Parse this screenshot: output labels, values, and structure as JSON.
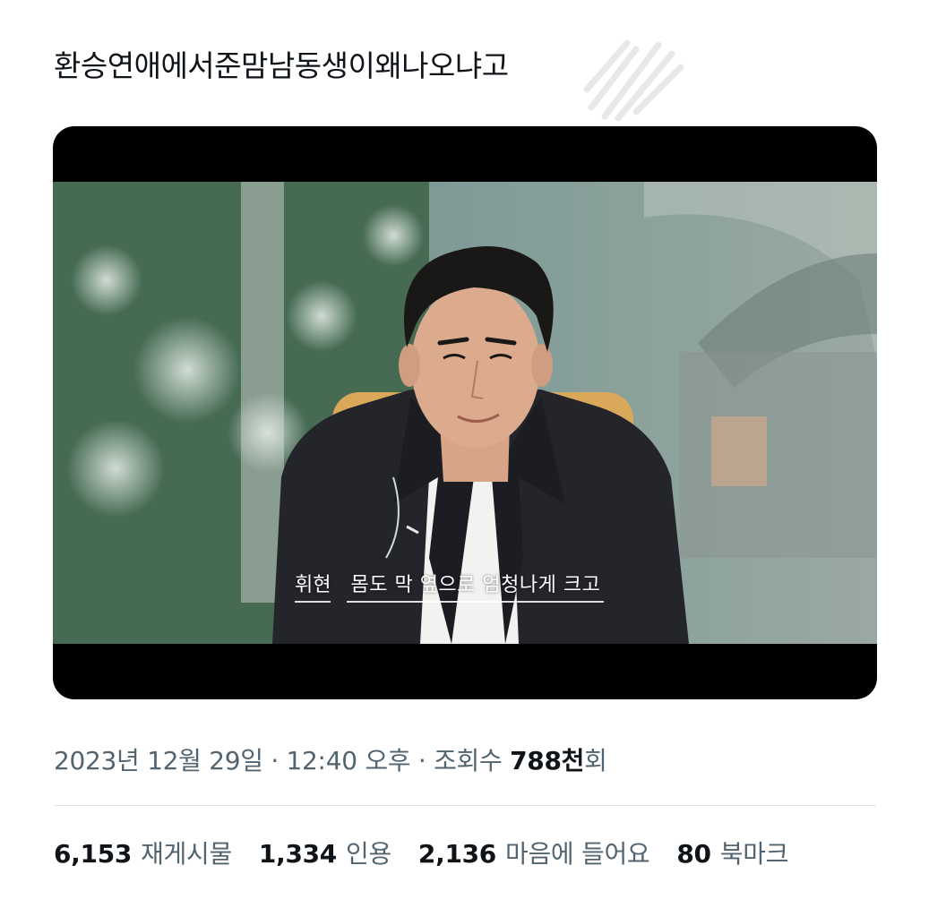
{
  "tweet": {
    "text": "환승연애에서준맘남동생이왜나오냐고"
  },
  "media": {
    "caption_speaker": "휘현",
    "caption_text": "몸도 막 옆으로 엄청나게 크고"
  },
  "meta": {
    "date": "2023년 12월 29일",
    "separator1": "·",
    "time": "12:40 오후",
    "separator2": "·",
    "views_label": "조회수",
    "views_num": "788천",
    "views_suffix": "회"
  },
  "stats": {
    "retweets_num": "6,153",
    "retweets_label": "재게시물",
    "quotes_num": "1,334",
    "quotes_label": "인용",
    "likes_num": "2,136",
    "likes_label": "마음에 들어요",
    "bookmarks_num": "80",
    "bookmarks_label": "북마크"
  }
}
